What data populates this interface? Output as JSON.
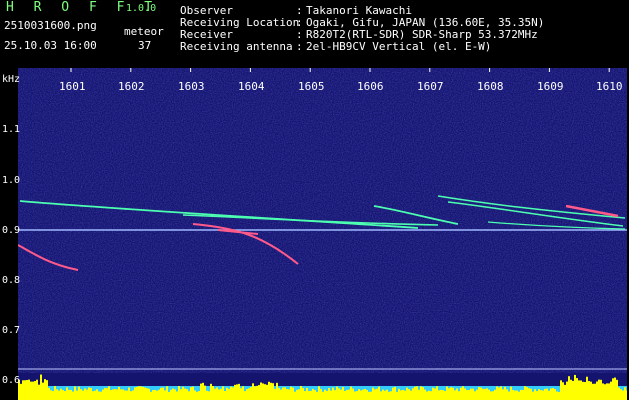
{
  "header": {
    "app_title": "H R O F F T",
    "version": "1.0.0",
    "file_name": "2510031600.png",
    "datetime": "25.10.03 16:00",
    "counter_label": "meteor",
    "counter_value": "37"
  },
  "info": [
    {
      "label": "Observer",
      "value": "Takanori Kawachi"
    },
    {
      "label": "Receiving Location",
      "value": "Ogaki, Gifu, JAPAN (136.60E, 35.35N)"
    },
    {
      "label": "Receiver",
      "value": "R820T2(RTL-SDR) SDR-Sharp 53.372MHz"
    },
    {
      "label": "Receiving antenna",
      "value": "2el-HB9CV Vertical (el. E-W)"
    }
  ],
  "plot": {
    "unit_label": "kHz",
    "x_ticks": [
      "1601",
      "1602",
      "1603",
      "1604",
      "1605",
      "1606",
      "1607",
      "1608",
      "1609",
      "1610"
    ],
    "y_ticks": [
      "1.1",
      "1.0",
      "0.9",
      "0.8",
      "0.7",
      "0.6"
    ],
    "colors": {
      "background": "#14146e",
      "carrier": "#9fb8ff",
      "trail_hot": "#ff5a8a",
      "trail_mid": "#4dffb0",
      "bar_cyan": "#33ccff",
      "bar_yellow": "#ffff00"
    }
  }
}
